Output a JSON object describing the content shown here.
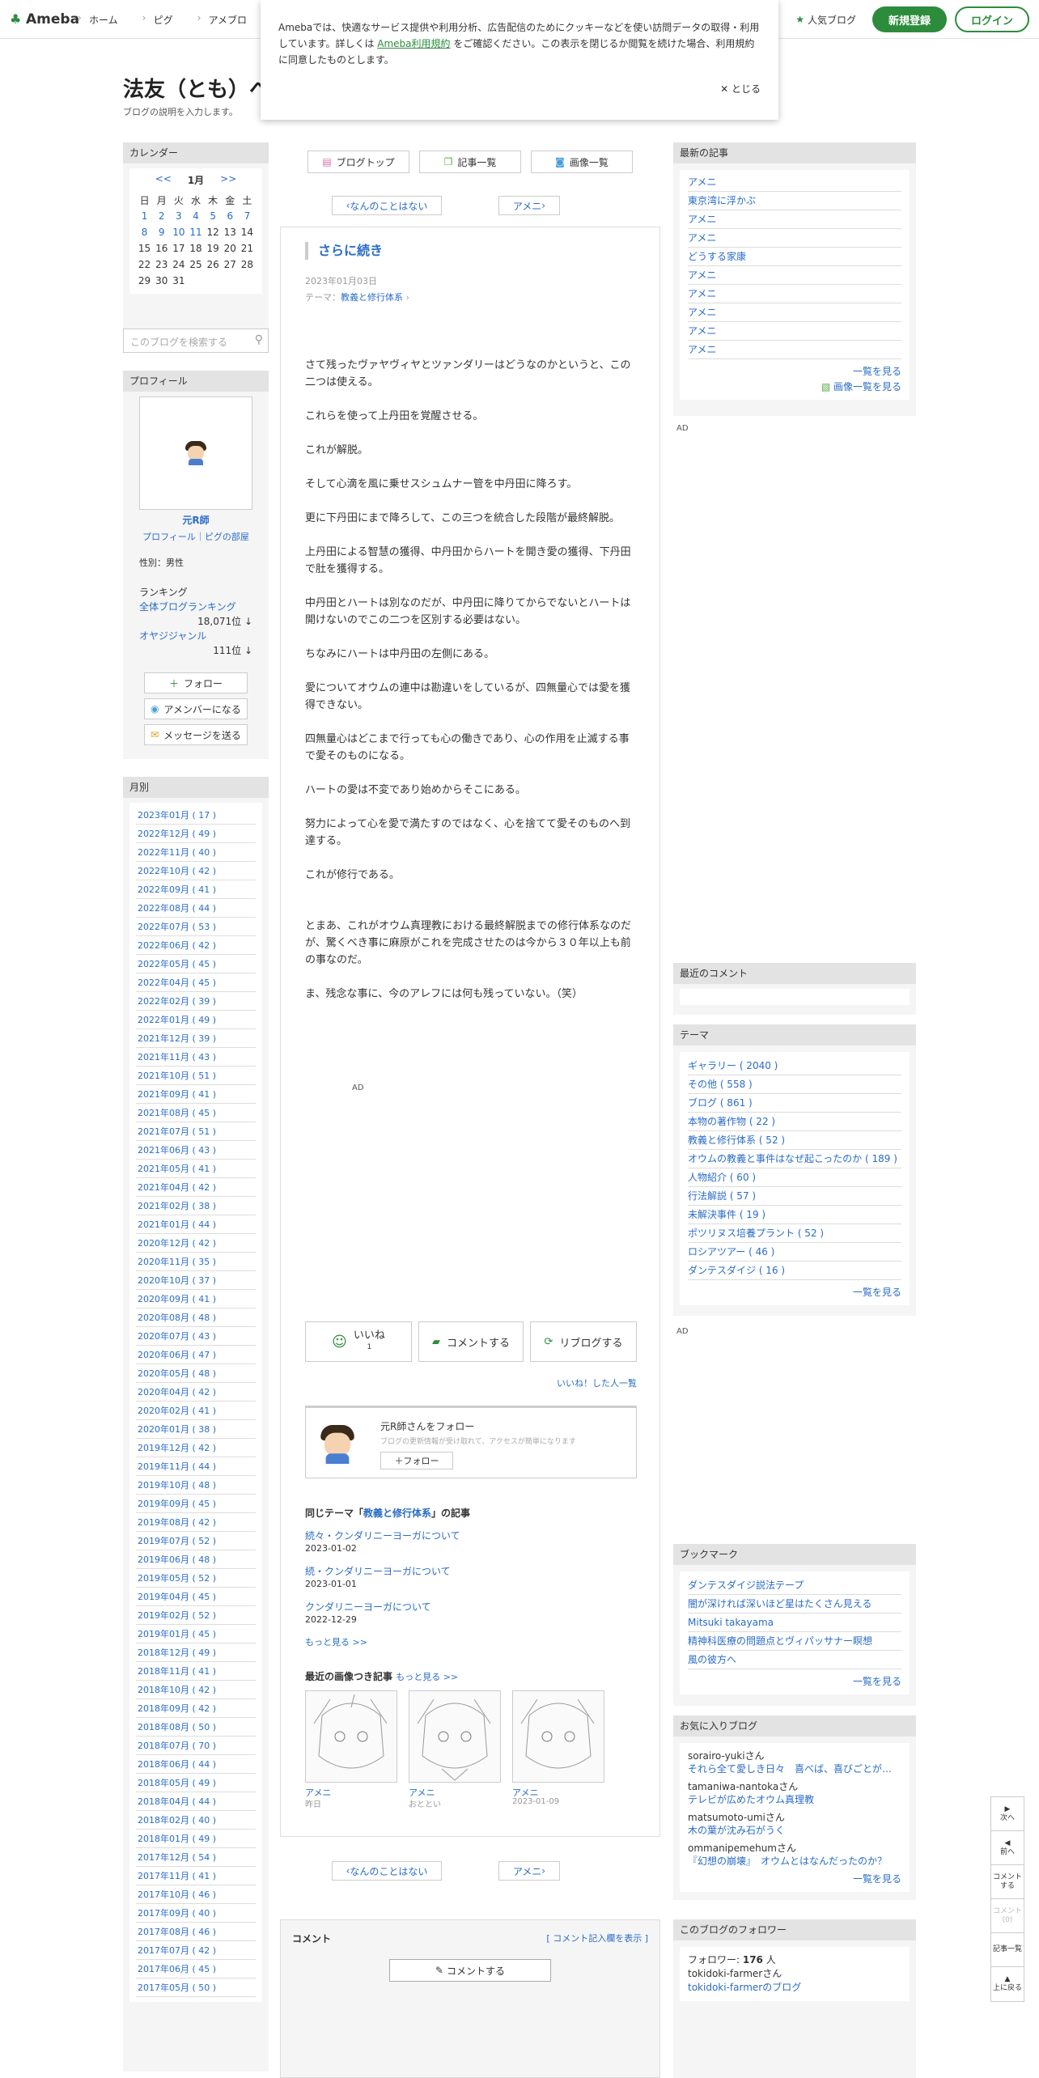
{
  "header": {
    "logo": "Ameba",
    "nav": [
      "ホーム",
      "ピグ",
      "アメブロ"
    ],
    "popular": "人気ブログ",
    "register": "新規登録",
    "login": "ログイン",
    "brand_color": "#2d8c3c"
  },
  "cookie": {
    "text1": "Amebaでは、快適なサービス提供や利用分析、広告配信のためにクッキーなどを使い訪問データの取得・利用しています。詳しくは ",
    "link": "Ameba利用規約",
    "text2": " をご確認ください。この表示を閉じるか閲覧を続けた場合、利用規約に同意したものとします。",
    "close": "とじる"
  },
  "blog": {
    "title": "法友（とも）へ",
    "description": "ブログの説明を入力します。"
  },
  "calendar": {
    "heading": "カレンダー",
    "prev": "<<",
    "month": "1月",
    "next": ">>",
    "weekdays": [
      "日",
      "月",
      "火",
      "水",
      "木",
      "金",
      "土"
    ],
    "rows": [
      [
        "1",
        "2",
        "3",
        "4",
        "5",
        "6",
        "7"
      ],
      [
        "8",
        "9",
        "10",
        "11",
        "12",
        "13",
        "14"
      ],
      [
        "15",
        "16",
        "17",
        "18",
        "19",
        "20",
        "21"
      ],
      [
        "22",
        "23",
        "24",
        "25",
        "26",
        "27",
        "28"
      ],
      [
        "29",
        "30",
        "31",
        "",
        "",
        "",
        ""
      ]
    ]
  },
  "search": {
    "placeholder": "このブログを検索する"
  },
  "profile": {
    "heading": "プロフィール",
    "name": "元R師",
    "links": "プロフィール｜ピグの部屋",
    "sex": "性別：男性",
    "ranking_label": "ランキング",
    "overall_label": "全体ブログランキング",
    "overall_value": "18,071位 ↓",
    "genre_label": "オヤジジャンル",
    "genre_value": "111位 ↓",
    "follow": "フォロー",
    "amember": "アメンバーになる",
    "message": "メッセージを送る"
  },
  "monthly": {
    "heading": "月別",
    "items": [
      "2023年01月 ( 17 )",
      "2022年12月 ( 49 )",
      "2022年11月 ( 40 )",
      "2022年10月 ( 42 )",
      "2022年09月 ( 41 )",
      "2022年08月 ( 44 )",
      "2022年07月 ( 53 )",
      "2022年06月 ( 42 )",
      "2022年05月 ( 45 )",
      "2022年04月 ( 45 )",
      "2022年02月 ( 39 )",
      "2022年01月 ( 49 )",
      "2021年12月 ( 39 )",
      "2021年11月 ( 43 )",
      "2021年10月 ( 51 )",
      "2021年09月 ( 41 )",
      "2021年08月 ( 45 )",
      "2021年07月 ( 51 )",
      "2021年06月 ( 43 )",
      "2021年05月 ( 41 )",
      "2021年04月 ( 42 )",
      "2021年02月 ( 38 )",
      "2021年01月 ( 44 )",
      "2020年12月 ( 42 )",
      "2020年11月 ( 35 )",
      "2020年10月 ( 37 )",
      "2020年09月 ( 41 )",
      "2020年08月 ( 48 )",
      "2020年07月 ( 43 )",
      "2020年06月 ( 47 )",
      "2020年05月 ( 48 )",
      "2020年04月 ( 42 )",
      "2020年02月 ( 41 )",
      "2020年01月 ( 38 )",
      "2019年12月 ( 42 )",
      "2019年11月 ( 44 )",
      "2019年10月 ( 48 )",
      "2019年09月 ( 45 )",
      "2019年08月 ( 42 )",
      "2019年07月 ( 52 )",
      "2019年06月 ( 48 )",
      "2019年05月 ( 52 )",
      "2019年04月 ( 45 )",
      "2019年02月 ( 52 )",
      "2019年01月 ( 45 )",
      "2018年12月 ( 49 )",
      "2018年11月 ( 41 )",
      "2018年10月 ( 42 )",
      "2018年09月 ( 42 )",
      "2018年08月 ( 50 )",
      "2018年07月 ( 70 )",
      "2018年06月 ( 44 )",
      "2018年05月 ( 49 )",
      "2018年04月 ( 44 )",
      "2018年02月 ( 40 )",
      "2018年01月 ( 49 )",
      "2017年12月 ( 54 )",
      "2017年11月 ( 41 )",
      "2017年10月 ( 46 )",
      "2017年09月 ( 40 )",
      "2017年08月 ( 46 )",
      "2017年07月 ( 42 )",
      "2017年06月 ( 45 )",
      "2017年05月 ( 50 )"
    ]
  },
  "toolbar": {
    "blog_top": "ブログトップ",
    "entries": "記事一覧",
    "images": "画像一覧"
  },
  "pager": {
    "prev": "なんのことはない",
    "next": "アメニ"
  },
  "article": {
    "title": "さらに続き",
    "date": "2023年01月03日",
    "theme_label": "テーマ：",
    "theme": "教義と修行体系",
    "paragraphs": [
      "さて残ったヴァヤヴィヤとツァンダリーはどうなのかというと、この二つは使える。",
      "これらを使って上丹田を覚醒させる。",
      "これが解脱。",
      "そして心滴を風に乗せスシュムナー管を中丹田に降ろす。",
      "更に下丹田にまで降ろして、この三つを統合した段階が最終解脱。",
      "上丹田による智慧の獲得、中丹田からハートを開き愛の獲得、下丹田で肚を獲得する。",
      "中丹田とハートは別なのだが、中丹田に降りてからでないとハートは開けないのでこの二つを区別する必要はない。",
      "ちなみにハートは中丹田の左側にある。",
      "愛についてオウムの連中は勘違いをしているが、四無量心では愛を獲得できない。",
      "四無量心はどこまで行っても心の働きであり、心の作用を止滅する事で愛そのものになる。",
      "ハートの愛は不変であり始めからそこにある。",
      "努力によって心を愛で満たすのではなく、心を捨てて愛そのものへ到達する。",
      "これが修行である。",
      "とまあ、これがオウム真理教における最終解脱までの修行体系なのだが、驚くべき事に麻原がこれを完成させたのは今から３０年以上も前の事なのだ。",
      "ま、残念な事に、今のアレフには何も残っていない。（笑）"
    ],
    "ad": "AD",
    "like": "いいね",
    "like_count": "1",
    "comment": "コメントする",
    "reblog": "リブログする",
    "liked_list": "いいね！した人一覧",
    "follow_title": "元R師さんをフォロー",
    "follow_desc": "ブログの更新情報が受け取れて、アクセスが簡単になります",
    "follow_btn": "フォロー",
    "same_theme_pre": "同じテーマ「",
    "same_theme_name": "教義と修行体系",
    "same_theme_post": "」の記事",
    "related": [
      {
        "title": "続々・クンダリニーヨーガについて",
        "date": "2023-01-02"
      },
      {
        "title": "続・クンダリニーヨーガについて",
        "date": "2023-01-01"
      },
      {
        "title": "クンダリニーヨーガについて",
        "date": "2022-12-29"
      }
    ],
    "more": "もっと見る >>",
    "recent_images": "最近の画像つき記事",
    "recent_more": "もっと見る >>",
    "images": [
      {
        "title": "アメニ",
        "date": "昨日"
      },
      {
        "title": "アメニ",
        "date": "おととい"
      },
      {
        "title": "アメニ",
        "date": "2023-01-09"
      }
    ]
  },
  "comments": {
    "heading": "コメント",
    "show_form": "[ コメント記入欄を表示 ]",
    "button": "コメントする"
  },
  "latest": {
    "heading": "最新の記事",
    "items": [
      "アメニ",
      "東京湾に浮かぶ",
      "アメニ",
      "アメニ",
      "どうする家康",
      "アメニ",
      "アメニ",
      "アメニ",
      "アメニ",
      "アメニ"
    ],
    "more": "一覧を見る",
    "images": "画像一覧を見る"
  },
  "recent_comments": {
    "heading": "最近のコメント"
  },
  "themes": {
    "heading": "テーマ",
    "items": [
      "ギャラリー ( 2040 )",
      "その他 ( 558 )",
      "ブログ ( 861 )",
      "本物の著作物 ( 22 )",
      "教義と修行体系 ( 52 )",
      "オウムの教義と事件はなぜ起こったのか ( 189 )",
      "人物紹介 ( 60 )",
      "行法解説 ( 57 )",
      "未解決事件 ( 19 )",
      "ポツリヌス培養プラント ( 52 )",
      "ロシアツアー ( 46 )",
      "ダンテスダイジ ( 16 )"
    ],
    "more": "一覧を見る"
  },
  "bookmarks": {
    "heading": "ブックマーク",
    "items": [
      "ダンテスダイジ説法テープ",
      "闇が深ければ深いほど星はたくさん見える",
      "Mitsuki takayama",
      "精神科医療の問題点とヴィパッサナー瞑想",
      "風の彼方へ"
    ],
    "more": "一覧を見る"
  },
  "favorites": {
    "heading": "お気に入りブログ",
    "items": [
      {
        "user": "sorairo-yukiさん",
        "title": "それら全て愛しき日々　喜べば、喜びごとが…"
      },
      {
        "user": "tamaniwa-nantokaさん",
        "title": "テレビが広めたオウム真理教"
      },
      {
        "user": "matsumoto-umiさん",
        "title": "木の葉が沈み石がうく"
      },
      {
        "user": "ommanipemehumさん",
        "title": "『幻想の崩壊』　オウムとはなんだったのか？"
      }
    ],
    "more": "一覧を見る"
  },
  "followers": {
    "heading": "このブログのフォロワー",
    "count_label": "フォロワー: ",
    "count": "176",
    "count_unit": " 人",
    "user": "tokidoki-farmerさん",
    "blog": "tokidoki-farmerのブログ"
  },
  "floatnav": {
    "next": "次へ",
    "prev": "前へ",
    "comment": "コメントする",
    "comment_count": "コメント(0)",
    "entries": "記事一覧",
    "top": "上に戻る"
  }
}
